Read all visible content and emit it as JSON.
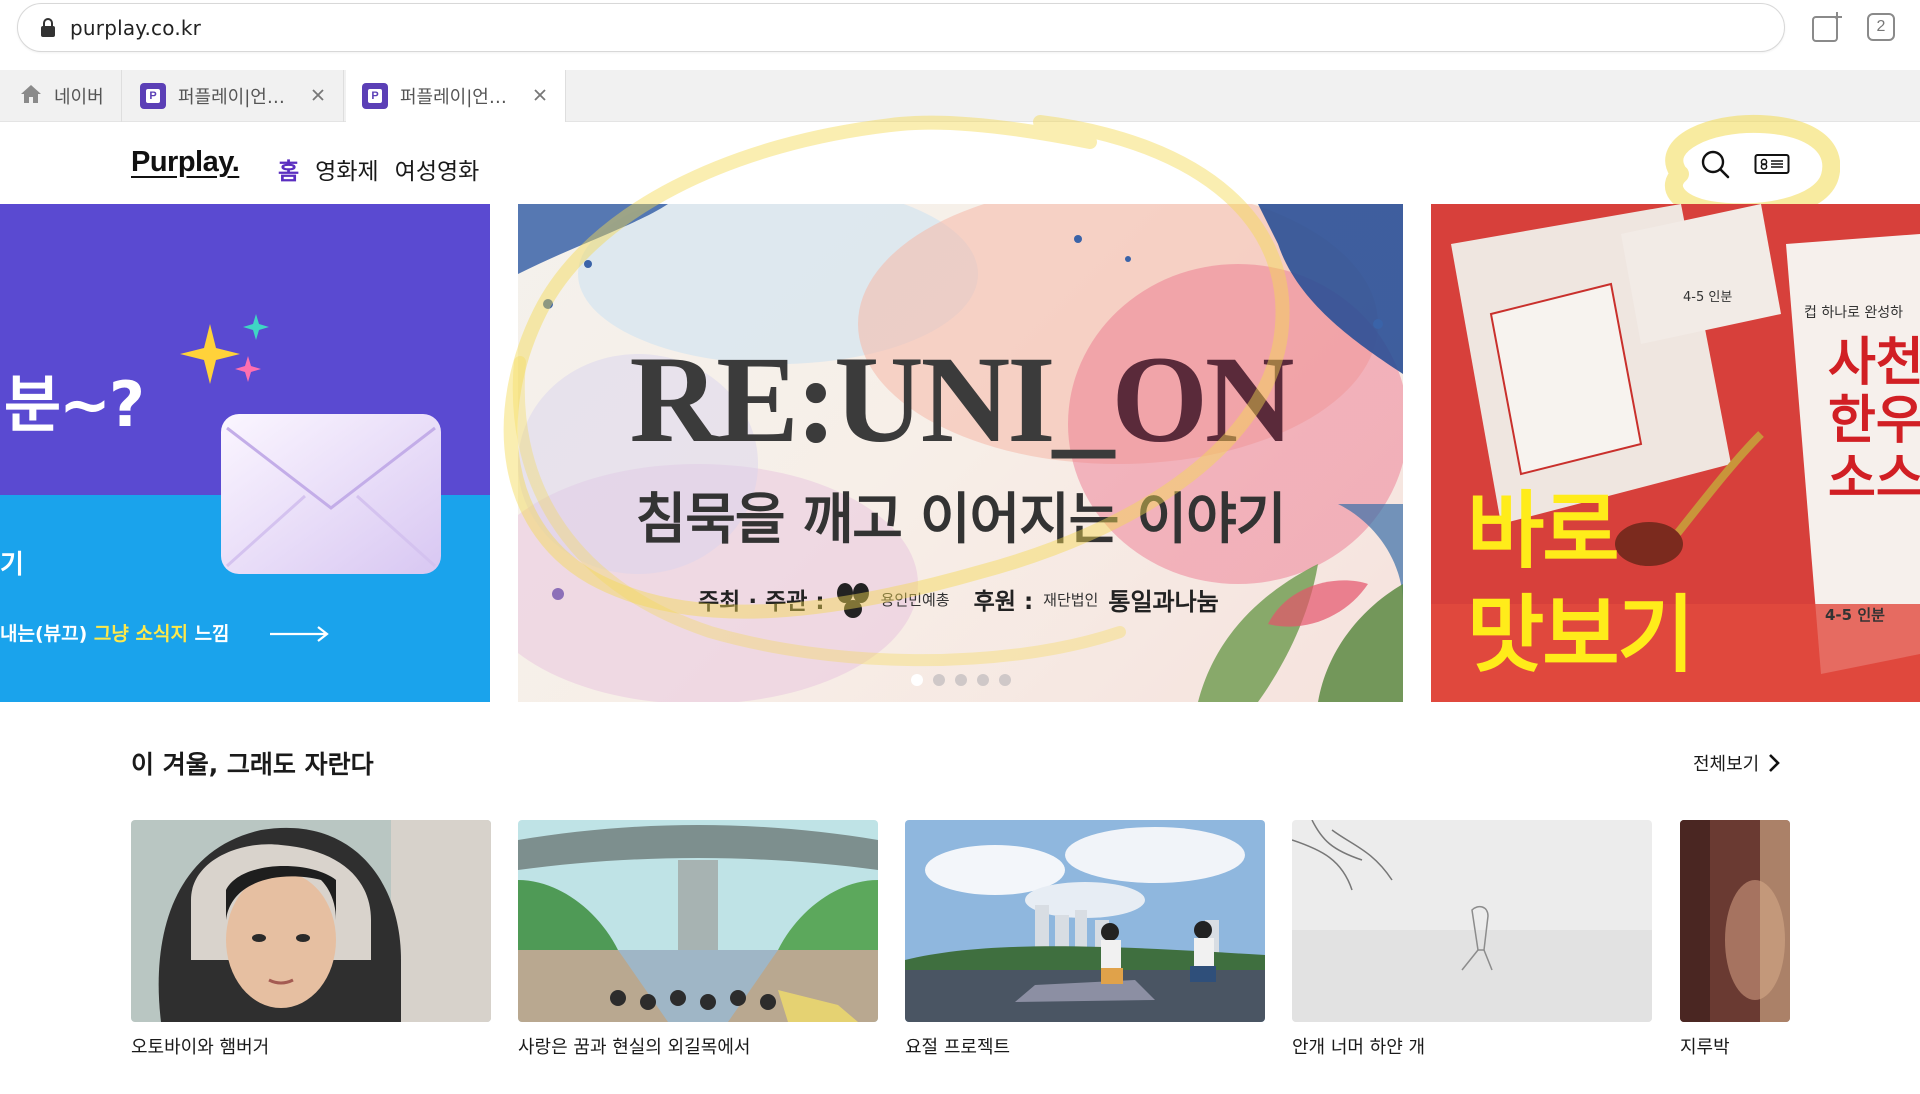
{
  "browser": {
    "url": "purplay.co.kr",
    "tab_count": "2",
    "tabs": [
      {
        "label": "네이버"
      },
      {
        "label": "퍼플레이|언…"
      },
      {
        "label": "퍼플레이|언…"
      }
    ]
  },
  "header": {
    "logo": "Purplay.",
    "nav": [
      {
        "label": "홈",
        "active": true
      },
      {
        "label": "영화제"
      },
      {
        "label": "여성영화"
      }
    ]
  },
  "hero": {
    "left": {
      "headline": "분~?",
      "side_text": "기",
      "caption_prefix": "내는(뷰끄)",
      "caption_highlight": "그냥 소식지",
      "caption_suffix": "느낌"
    },
    "main": {
      "title_a": "RE:UNI_",
      "title_b": "ON",
      "subtitle": "침묵을 깨고 이어지는 이야기",
      "credit_host": "주최 · 주관 :",
      "credit_host_org": "용인민예총",
      "credit_sponsor": "후원 :",
      "credit_sponsor_org_small": "재단법인",
      "credit_sponsor_org": "통일과나눔",
      "dots": 5,
      "active_dot": 0
    },
    "right": {
      "headline_line1": "바로",
      "headline_line2": "맛보기",
      "package_small": "컵 하나로 완성하",
      "package_big": "사천한우소스",
      "tag1": "4-5 인분",
      "tag2": "4-5 인분"
    }
  },
  "section": {
    "title": "이 겨울, 그래도 자란다",
    "see_all": "전체보기",
    "cards": [
      {
        "title": "오토바이와 햄버거"
      },
      {
        "title": "사랑은 꿈과 현실의 외길목에서"
      },
      {
        "title": "요절 프로젝트"
      },
      {
        "title": "안개 너머 하얀 개"
      },
      {
        "title": "지루박"
      }
    ]
  },
  "colors": {
    "brand_purple": "#5b2fc0",
    "annotation_yellow": "#f6e27a"
  }
}
